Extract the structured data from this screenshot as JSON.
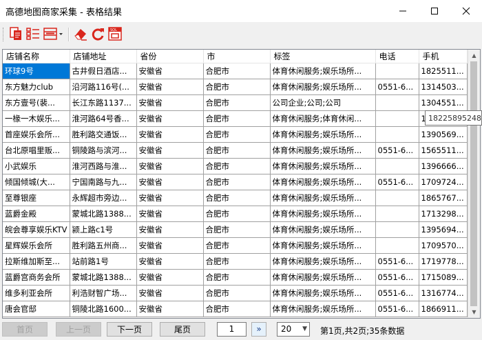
{
  "window": {
    "title": "高德地图商家采集 - 表格结果"
  },
  "toolbar": {
    "icons": [
      "copy-icon",
      "list-icon",
      "columns-icon",
      "eraser-icon",
      "refresh-icon",
      "sql-icon"
    ]
  },
  "columns": [
    "店铺名称",
    "店铺地址",
    "省份",
    "市",
    "标签",
    "电话",
    "手机"
  ],
  "rows": [
    [
      "环球9号",
      "古井假日酒店...",
      "安徽省",
      "合肥市",
      "体育休闲服务;娱乐场所...",
      "",
      "1825511..."
    ],
    [
      "东方魅力club",
      "沿河路116号(...",
      "安徽省",
      "合肥市",
      "体育休闲服务;娱乐场所...",
      "0551-6...",
      "1314503..."
    ],
    [
      "东方壹号(裴...",
      "长江东路1137...",
      "安徽省",
      "合肥市",
      "公司企业;公司;公司",
      "",
      "1304551..."
    ],
    [
      "一椽一木娱乐...",
      "淮河路64号香...",
      "安徽省",
      "合肥市",
      "体育休闲服务;体育休闲...",
      "",
      "1"
    ],
    [
      "首座娱乐会所...",
      "胜利路交通饭...",
      "安徽省",
      "合肥市",
      "体育休闲服务;娱乐场所...",
      "",
      "1390569..."
    ],
    [
      "台北原唱里贩...",
      "铜陵路与滨河...",
      "安徽省",
      "合肥市",
      "体育休闲服务;娱乐场所...",
      "0551-6...",
      "1565511..."
    ],
    [
      "小武娱乐",
      "淮河西路与淮...",
      "安徽省",
      "合肥市",
      "体育休闲服务;娱乐场所...",
      "",
      "1396666..."
    ],
    [
      "倾国倾城(大...",
      "宁国南路与九...",
      "安徽省",
      "合肥市",
      "体育休闲服务;娱乐场所...",
      "0551-6...",
      "1709724..."
    ],
    [
      "至尊银座",
      "永辉超市旁边...",
      "安徽省",
      "合肥市",
      "体育休闲服务;娱乐场所...",
      "",
      "1865767..."
    ],
    [
      "蓝爵金殿",
      "蒙城北路1388...",
      "安徽省",
      "合肥市",
      "体育休闲服务;娱乐场所...",
      "",
      "1713298..."
    ],
    [
      "皖会尊享娱乐KTV",
      "颍上路c1号",
      "安徽省",
      "合肥市",
      "体育休闲服务;娱乐场所...",
      "",
      "1395694..."
    ],
    [
      "星辉娱乐会所",
      "胜利路五州商...",
      "安徽省",
      "合肥市",
      "体育休闲服务;娱乐场所...",
      "",
      "1709570..."
    ],
    [
      "拉斯维加斯至...",
      "站前路1号",
      "安徽省",
      "合肥市",
      "体育休闲服务;娱乐场所...",
      "0551-6...",
      "1719778..."
    ],
    [
      "蓝爵宫商务会所",
      "蒙城北路1388...",
      "安徽省",
      "合肥市",
      "体育休闲服务;娱乐场所...",
      "0551-6...",
      "1715089..."
    ],
    [
      "维多利亚会所",
      "利浩财智广场...",
      "安徽省",
      "合肥市",
      "体育休闲服务;娱乐场所...",
      "0551-6...",
      "1316774..."
    ],
    [
      "唐会官邸",
      "铜陵北路1600...",
      "安徽省",
      "合肥市",
      "体育休闲服务;娱乐场所...",
      "0551-6...",
      "1866911..."
    ]
  ],
  "tooltip": "18225895248",
  "pager": {
    "first": "首页",
    "prev": "上一页",
    "next": "下一页",
    "last": "尾页",
    "page_value": "1",
    "go": "»",
    "page_size": "20",
    "info": "第1页,共2页;35条数据"
  },
  "colors": {
    "selection": "#0078d7",
    "toolbar_red": "#d9261c"
  }
}
